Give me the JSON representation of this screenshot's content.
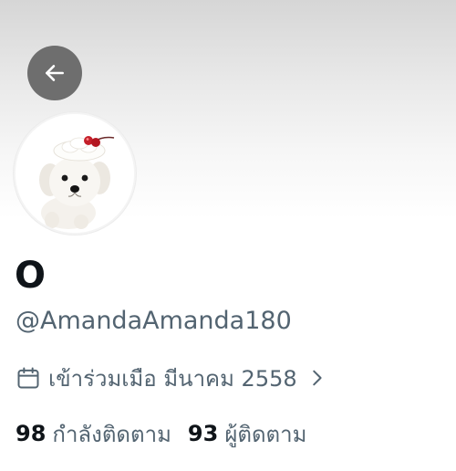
{
  "header": {
    "back_icon": "arrow-left-icon"
  },
  "profile": {
    "avatar_icon": "white-puppy-with-cream-hat-avatar",
    "display_name": "O",
    "handle": "@AmandaAmanda180",
    "joined_icon": "calendar-icon",
    "joined_text": "เข้าร่วมเมือ มีนาคม 2558",
    "joined_chevron_icon": "chevron-right-icon",
    "following_count": "98",
    "following_label": "กำลังติดตาม",
    "followers_count": "93",
    "followers_label": "ผู้ติดตาม"
  },
  "colors": {
    "primary_text": "#0f1419",
    "secondary_text": "#536471",
    "back_button_bg": "#6e6e6e"
  }
}
